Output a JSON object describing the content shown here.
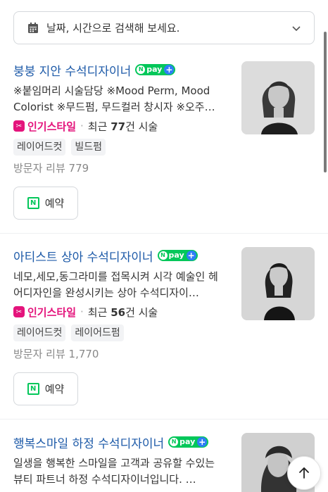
{
  "search": {
    "placeholder": "날짜, 시간으로 검색해 보세요."
  },
  "npay_label": "pay",
  "reserve_label": "예약",
  "popular_label": "인기스타일",
  "cards": [
    {
      "name": "붕붕 지안 수석디자이너",
      "desc": "※붙임머리 시술담당 ※Mood Perm, Mood Colorist ※무드펌, 무드컬러 창시자 ※오주…",
      "recent_prefix": "최근",
      "recent_count": "77",
      "recent_suffix": "건 시술",
      "tags": [
        "레이어드컷",
        "빌드펌"
      ],
      "reviews": "방문자 리뷰 779"
    },
    {
      "name": "아티스트 상아 수석디자이너",
      "desc": "네모,세모,동그라미를 접목시켜 시각 예술인 헤어디자인을 완성시키는 상아 수석디자이…",
      "recent_prefix": "최근",
      "recent_count": "56",
      "recent_suffix": "건 시술",
      "tags": [
        "레이어드컷",
        "레이어드펌"
      ],
      "reviews": "방문자 리뷰 1,770"
    },
    {
      "name": "행복스마일 하정 수석디자이너",
      "desc": "일생을 행복한 스마일을 고객과 공유할 수있는 뷰티 파트너 하정 수석디자이너입니다. …"
    }
  ]
}
